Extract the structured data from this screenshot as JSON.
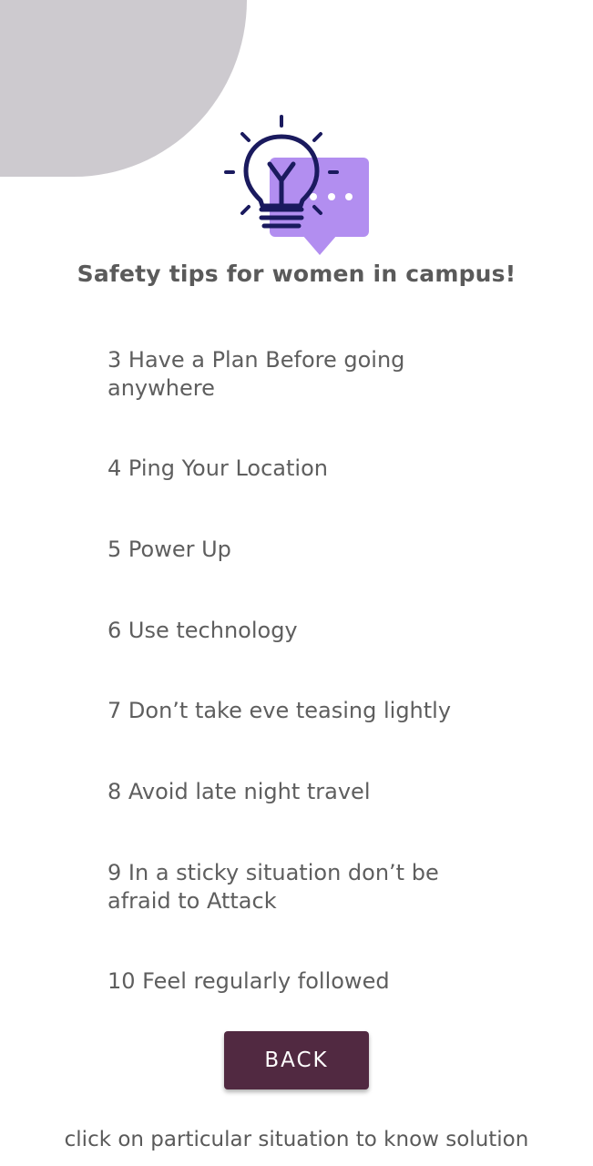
{
  "header": {
    "logo_icon": "lightbulb-chat-icon",
    "title": "Safety tips for women in campus!"
  },
  "tips": [
    {
      "label": "3 Have a Plan Before going anywhere"
    },
    {
      "label": "4 Ping Your Location"
    },
    {
      "label": "5 Power Up"
    },
    {
      "label": "6 Use technology"
    },
    {
      "label": "7 Don’t take eve teasing lightly"
    },
    {
      "label": "8 Avoid late night travel"
    },
    {
      "label": "9 In a sticky situation don’t be afraid to Attack"
    },
    {
      "label": "10  Feel regularly followed"
    }
  ],
  "back_button": {
    "label": "BACK"
  },
  "footer": {
    "hint": "click on particular situation to know solution"
  },
  "colors": {
    "accent": "#512941",
    "bulb": "#1a1a5e",
    "bubble": "#b28ef0",
    "corner": "#cdcacf",
    "text": "#5e5e5e"
  }
}
